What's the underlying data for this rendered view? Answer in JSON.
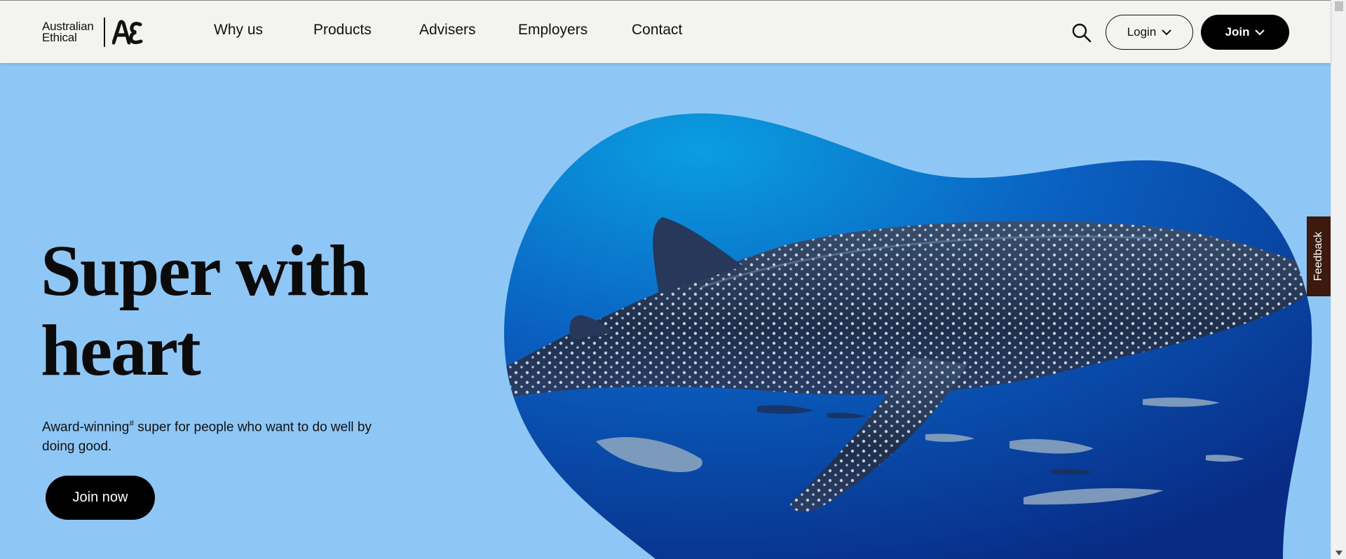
{
  "brand": {
    "name_line1": "Australian",
    "name_line2": "Ethical",
    "logo_mark": "AE-monogram"
  },
  "nav": {
    "items": [
      {
        "label": "Why us"
      },
      {
        "label": "Products"
      },
      {
        "label": "Advisers"
      },
      {
        "label": "Employers"
      },
      {
        "label": "Contact"
      }
    ]
  },
  "header_actions": {
    "search_icon": "search-icon",
    "login_label": "Login",
    "join_label": "Join"
  },
  "hero": {
    "title": "Super with heart",
    "subtitle_pre": "Award-winning",
    "subtitle_mark": "#",
    "subtitle_post": " super for people who want to do well by doing good.",
    "cta_label": "Join now",
    "image_subject": "whale-shark-underwater-photo"
  },
  "feedback": {
    "label": "Feedback"
  },
  "colors": {
    "hero_background": "#8ec7f6",
    "header_background": "#f3f4ef",
    "primary_button": "#000000",
    "feedback_tab": "#3c1a0e"
  }
}
